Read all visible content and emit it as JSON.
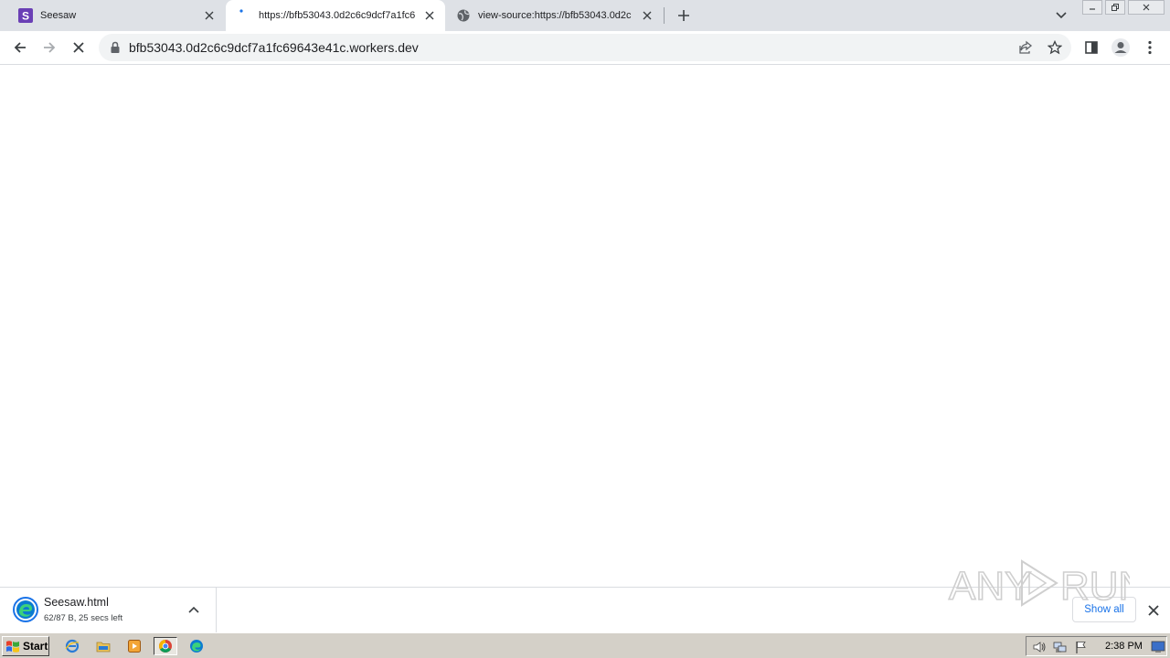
{
  "tabs": [
    {
      "title": "Seesaw",
      "favicon": "seesaw-favicon",
      "active": false
    },
    {
      "title": "https://bfb53043.0d2c6c9dcf7a1fc6",
      "favicon": "loading-icon",
      "active": true
    },
    {
      "title": "view-source:https://bfb53043.0d2c",
      "favicon": "globe-icon",
      "active": false
    }
  ],
  "omnibox": {
    "url": "bfb53043.0d2c6c9dcf7a1fc69643e41c.workers.dev"
  },
  "download_shelf": {
    "file_name": "Seesaw.html",
    "status": "62/87 B, 25 secs left",
    "show_all_label": "Show all"
  },
  "watermark": {
    "text": "ANY RUN"
  },
  "taskbar": {
    "start_label": "Start",
    "clock": "2:38 PM"
  },
  "colors": {
    "accent": "#1a73e8",
    "seesaw_brand": "#6a3fb5",
    "tabstrip": "#dee1e6",
    "taskbar": "#d4d0c8"
  }
}
